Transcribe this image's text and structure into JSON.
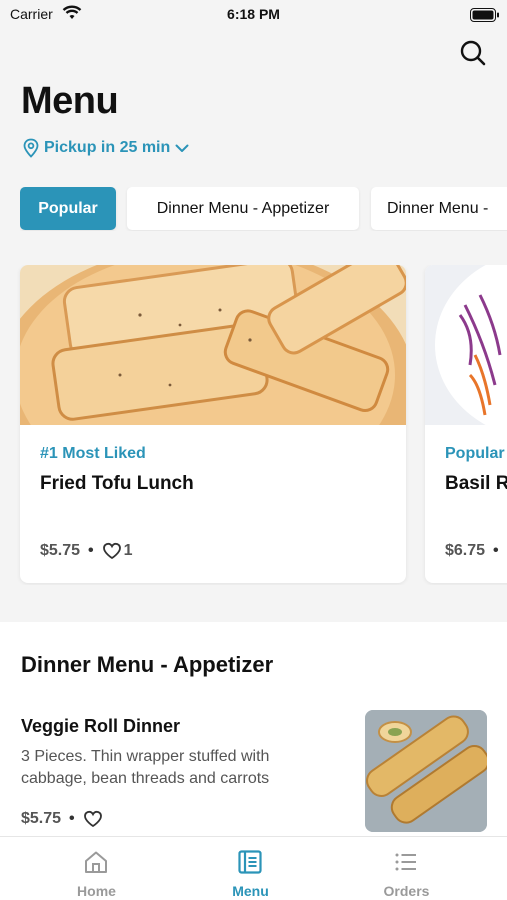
{
  "status_bar": {
    "carrier": "Carrier",
    "time": "6:18 PM"
  },
  "header": {
    "title": "Menu",
    "pickup_label": "Pickup in 25 min"
  },
  "tabs": [
    {
      "label": "Popular",
      "active": true
    },
    {
      "label": "Dinner Menu - Appetizer",
      "active": false
    },
    {
      "label": "Dinner Menu - ",
      "active": false
    }
  ],
  "featured": [
    {
      "tag": "#1 Most Liked",
      "name": "Fried Tofu Lunch",
      "price": "$5.75",
      "likes": "1"
    },
    {
      "tag": "Popular",
      "name": "Basil R",
      "price": "$6.75"
    }
  ],
  "section": {
    "title": "Dinner Menu - Appetizer",
    "items": [
      {
        "name": "Veggie Roll Dinner",
        "description": "3 Pieces. Thin wrapper stuffed with cabbage, bean threads and carrots",
        "price": "$5.75"
      }
    ]
  },
  "bottom_nav": [
    {
      "label": "Home",
      "icon": "home-icon",
      "active": false
    },
    {
      "label": "Menu",
      "icon": "menu-book-icon",
      "active": true
    },
    {
      "label": "Orders",
      "icon": "list-icon",
      "active": false
    }
  ],
  "colors": {
    "accent": "#2b94b8",
    "background": "#f4f4f4",
    "card": "#ffffff",
    "inactive": "#9a9a9a"
  }
}
